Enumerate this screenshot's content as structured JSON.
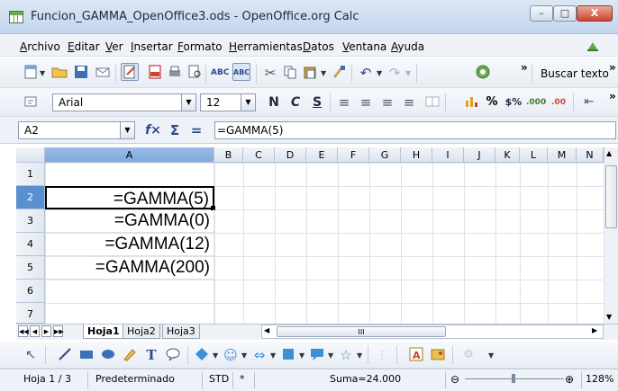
{
  "window": {
    "title": "Funcion_GAMMA_OpenOffice3.ods - OpenOffice.org Calc"
  },
  "menu": [
    "Archivo",
    "Editar",
    "Ver",
    "Insertar",
    "Formato",
    "Herramientas",
    "Datos",
    "Ventana",
    "Ayuda"
  ],
  "toolbar": {
    "find_label": "Buscar texto"
  },
  "format": {
    "font_name": "Arial",
    "font_size": "12"
  },
  "formula_bar": {
    "cell_ref": "A2",
    "content": "=GAMMA(5)"
  },
  "grid": {
    "columns": [
      "A",
      "B",
      "C",
      "D",
      "E",
      "F",
      "G",
      "H",
      "I",
      "J",
      "K",
      "L",
      "M",
      "N"
    ],
    "rows": [
      "1",
      "2",
      "3",
      "4",
      "5",
      "6",
      "7"
    ],
    "cells": {
      "A2": "=GAMMA(5)",
      "A3": "=GAMMA(0)",
      "A4": "=GAMMA(12)",
      "A5": "=GAMMA(200)"
    },
    "selected_cell": "A2"
  },
  "sheets": [
    "Hoja1",
    "Hoja2",
    "Hoja3"
  ],
  "active_sheet": "Hoja1",
  "status": {
    "page": "Hoja 1 / 3",
    "style": "Predeterminado",
    "mode": "STD",
    "modified": "*",
    "sum": "Suma=24.000",
    "zoom": "128%"
  },
  "colors": {
    "selection": "#5a8fd0",
    "header": "#dde4ee",
    "accent": "#c8452f"
  }
}
